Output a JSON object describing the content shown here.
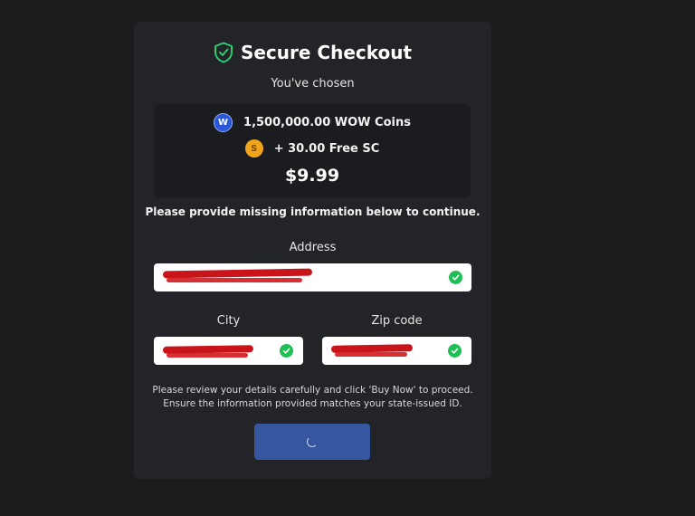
{
  "header": {
    "title": "Secure Checkout",
    "icon": "shield-check-icon",
    "icon_color": "#2ecc71"
  },
  "subtitle": "You've chosen",
  "summary": {
    "coins": {
      "icon": "wow-coin-icon",
      "icon_text": "W",
      "label": "1,500,000.00 WOW Coins"
    },
    "bonus": {
      "icon": "sc-coin-icon",
      "icon_text": "S",
      "label": "+ 30.00 Free SC"
    },
    "price": "$9.99"
  },
  "notice": "Please provide missing information below to continue.",
  "form": {
    "address_label": "Address",
    "city_label": "City",
    "zip_label": "Zip code"
  },
  "help_text": {
    "line1": "Please review your details carefully and click 'Buy Now' to proceed.",
    "line2": "Ensure the information provided matches your state-issued ID."
  },
  "colors": {
    "accent": "#36569f",
    "valid": "#1fbf55",
    "redaction": "#c9151a"
  }
}
